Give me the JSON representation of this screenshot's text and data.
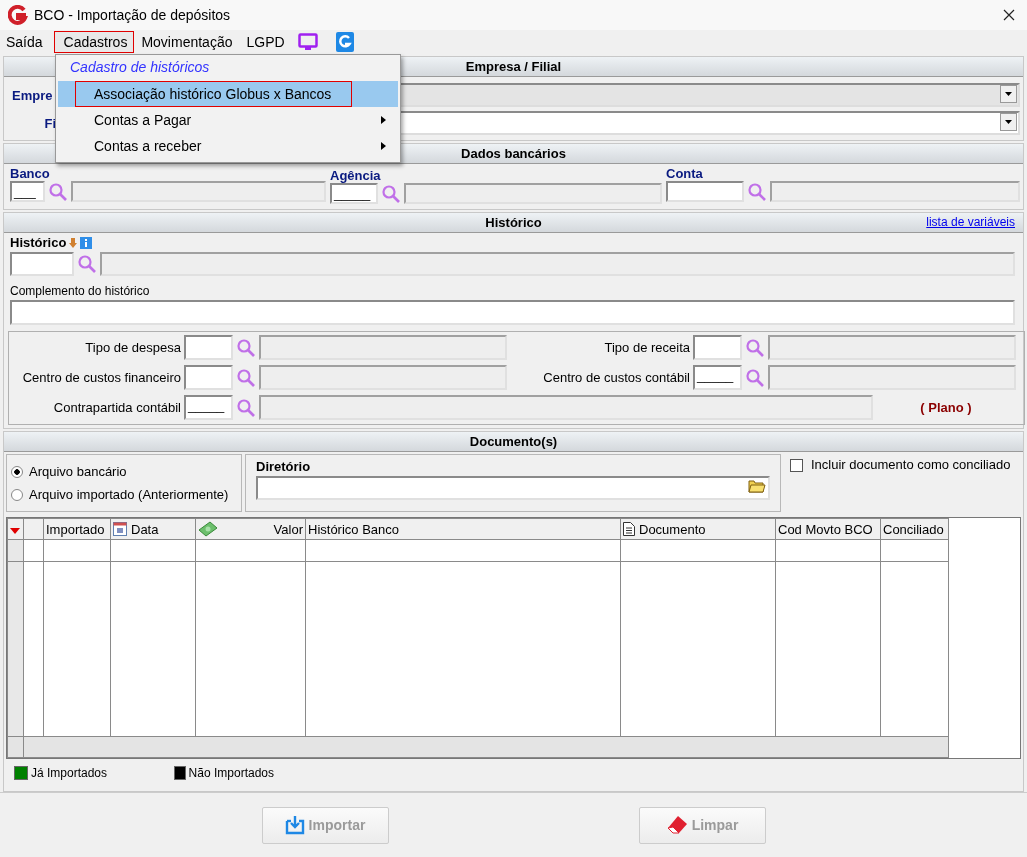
{
  "window": {
    "title": "BCO - Importação de depósitos"
  },
  "menu": [
    {
      "label": "Saída",
      "selected": false
    },
    {
      "label": "Cadastros",
      "selected": true
    },
    {
      "label": "Movimentação",
      "selected": false
    },
    {
      "label": "LGPD",
      "selected": false
    }
  ],
  "dropdown": {
    "header": "Cadastro de históricos",
    "items": [
      {
        "label": "Associação histórico Globus x Bancos",
        "selected": true,
        "submenu": false
      },
      {
        "label": "Contas a Pagar",
        "selected": false,
        "submenu": true
      },
      {
        "label": "Contas a receber",
        "selected": false,
        "submenu": true
      }
    ]
  },
  "empresa_filial": {
    "title": "Empresa / Filial",
    "empresa_label": "Empre",
    "filial_label": "Fi"
  },
  "dados_bancarios": {
    "title": "Dados bancários",
    "fields": [
      {
        "label": "Banco",
        "value": "___"
      },
      {
        "label": "Agência",
        "value": "_____"
      },
      {
        "label": "Conta"
      }
    ]
  },
  "historico": {
    "title": "Histórico",
    "link": "lista de variáveis",
    "label": "Histórico",
    "complemento_label": "Complemento do histórico",
    "left": [
      {
        "label": "Tipo de despesa"
      },
      {
        "label": "Centro de custos financeiro"
      },
      {
        "label": "Contrapartida contábil",
        "value": "_____"
      }
    ],
    "right": [
      {
        "label": "Tipo de receita"
      },
      {
        "label": "Centro de custos contábil",
        "value": "_____"
      }
    ],
    "plano": "( Plano )"
  },
  "documentos": {
    "title": "Documento(s)",
    "radios": [
      {
        "label": "Arquivo bancário",
        "selected": true
      },
      {
        "label": "Arquivo importado (Anteriormente)",
        "selected": false
      }
    ],
    "diretorio_label": "Diretório",
    "incluir": {
      "label": "Incluir documento como conciliado",
      "checked": false
    },
    "columns": [
      {
        "label": "Importado"
      },
      {
        "label": "Data",
        "kind": "calendar"
      },
      {
        "label": "Valor",
        "kind": "money"
      },
      {
        "label": "Histórico Banco"
      },
      {
        "label": "Documento",
        "kind": "document"
      },
      {
        "label": "Cod Movto BCO"
      },
      {
        "label": "Conciliado"
      }
    ],
    "legend": [
      {
        "label": "Já Importados",
        "color": "#008000"
      },
      {
        "label": "Não Importados",
        "color": "#000000"
      }
    ]
  },
  "buttons": [
    {
      "label": "Importar",
      "kind": "import",
      "disabled": true
    },
    {
      "label": "Limpar",
      "kind": "clear",
      "disabled": true
    }
  ]
}
